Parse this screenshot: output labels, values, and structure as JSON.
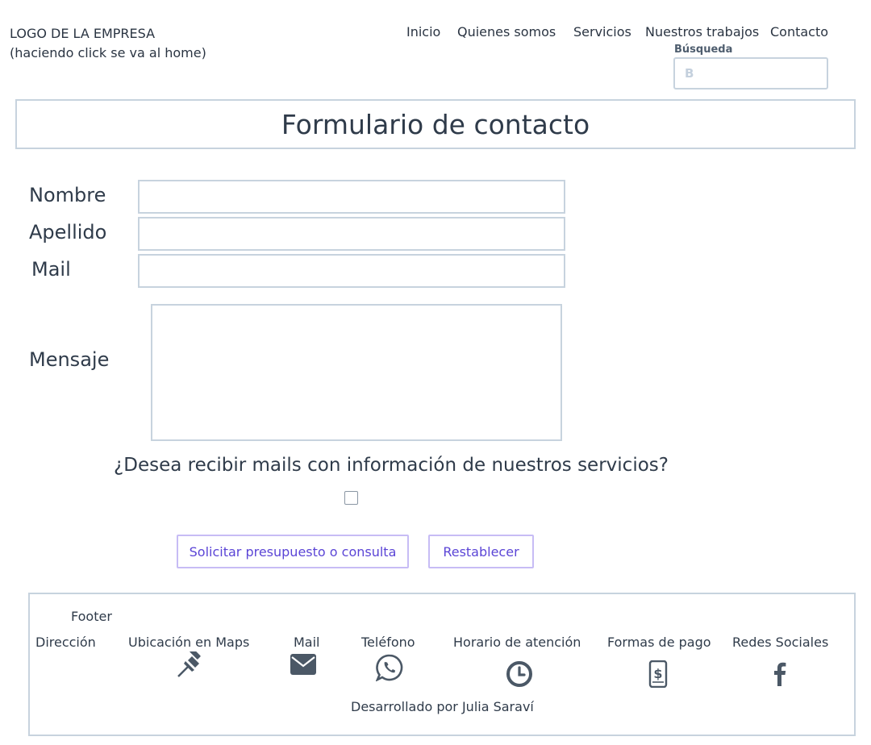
{
  "header": {
    "logo_line1": "LOGO DE LA EMPRESA",
    "logo_line2": "(haciendo click se va al home)",
    "nav": [
      "Inicio",
      "Quienes somos",
      "Servicios",
      "Nuestros trabajos",
      "Contacto"
    ],
    "search_label": "Búsqueda",
    "search_placeholder": "B"
  },
  "page_title": "Formulario de contacto",
  "form": {
    "labels": {
      "nombre": "Nombre",
      "apellido": "Apellido",
      "mail": "Mail",
      "mensaje": "Mensaje"
    },
    "newsletter_question": "¿Desea recibir mails con información de nuestros servicios?",
    "newsletter_checked": false,
    "submit_label": "Solicitar presupuesto o consulta",
    "reset_label": "Restablecer"
  },
  "footer": {
    "title": "Footer",
    "columns": [
      "Dirección",
      "Ubicación en Maps",
      "Mail",
      "Teléfono",
      "Horario de atención",
      "Formas de pago",
      "Redes Sociales"
    ],
    "icons": [
      "pushpin-icon",
      "envelope-icon",
      "whatsapp-icon",
      "clock-icon",
      "mobile-payment-icon",
      "facebook-icon"
    ],
    "credit": "Desarrollado por Julia Saraví"
  },
  "colors": {
    "border": "#c7d3de",
    "text": "#2f3b4a",
    "button_text": "#5b45d6",
    "button_border": "#c7bcf5",
    "icon": "#4b5866"
  }
}
